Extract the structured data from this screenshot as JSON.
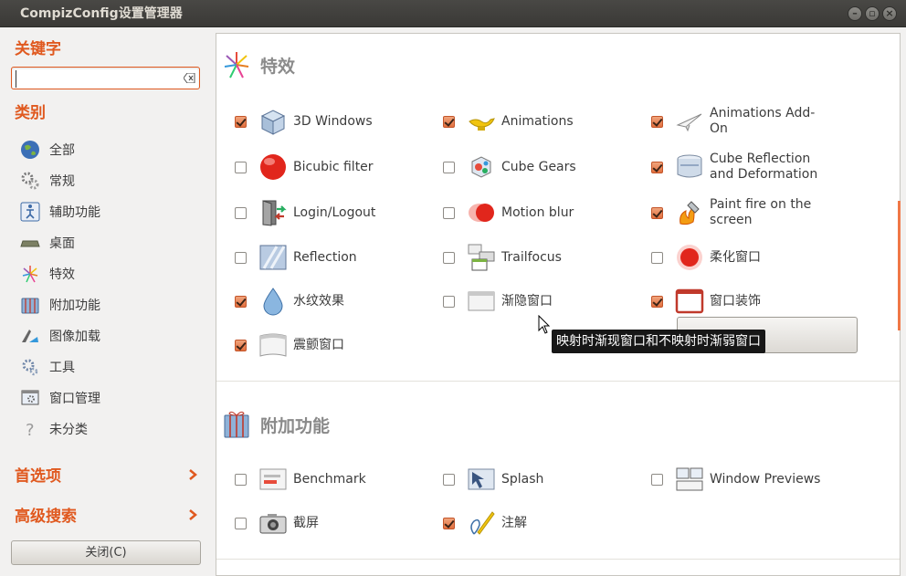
{
  "window": {
    "title": "CompizConfig设置管理器"
  },
  "sidebar": {
    "keyword_heading": "关键字",
    "search_value": "",
    "category_heading": "类别",
    "categories": [
      {
        "label": "全部",
        "icon": "globe-icon"
      },
      {
        "label": "常规",
        "icon": "gears-icon"
      },
      {
        "label": "辅助功能",
        "icon": "accessibility-icon"
      },
      {
        "label": "桌面",
        "icon": "desktop-icon"
      },
      {
        "label": "特效",
        "icon": "fireworks-icon"
      },
      {
        "label": "附加功能",
        "icon": "gift-icon"
      },
      {
        "label": "图像加载",
        "icon": "image-loading-icon"
      },
      {
        "label": "工具",
        "icon": "tools-icon"
      },
      {
        "label": "窗口管理",
        "icon": "window-management-icon"
      },
      {
        "label": "未分类",
        "icon": "question-icon"
      }
    ],
    "preferences_label": "首选项",
    "advanced_search_label": "高级搜索",
    "close_label": "关闭(C)"
  },
  "sections": [
    {
      "title": "特效",
      "icon": "fireworks-icon",
      "plugins": [
        {
          "label": "3D Windows",
          "checked": true,
          "icon": "3d-windows-icon"
        },
        {
          "label": "Animations",
          "checked": true,
          "icon": "magic-lamp-icon"
        },
        {
          "label": "Animations Add-On",
          "checked": true,
          "icon": "paper-plane-icon"
        },
        {
          "label": "Bicubic filter",
          "checked": false,
          "icon": "red-sphere-icon"
        },
        {
          "label": "Cube Gears",
          "checked": false,
          "icon": "cube-gears-icon"
        },
        {
          "label": "Cube Reflection and Deformation",
          "checked": true,
          "icon": "cylinder-icon"
        },
        {
          "label": "Login/Logout",
          "checked": false,
          "icon": "door-icon"
        },
        {
          "label": "Motion blur",
          "checked": false,
          "icon": "motion-blur-icon"
        },
        {
          "label": "Paint fire on the screen",
          "checked": true,
          "icon": "fire-icon"
        },
        {
          "label": "Reflection",
          "checked": false,
          "icon": "reflection-icon"
        },
        {
          "label": "Trailfocus",
          "checked": false,
          "icon": "trailfocus-icon"
        },
        {
          "label": "柔化窗口",
          "checked": false,
          "icon": "glow-sphere-icon"
        },
        {
          "label": "水纹效果",
          "checked": true,
          "icon": "water-drop-icon"
        },
        {
          "label": "渐隐窗口",
          "checked": false,
          "icon": "fading-window-icon"
        },
        {
          "label": "窗口装饰",
          "checked": true,
          "icon": "window-decoration-icon"
        },
        {
          "label": "震颤窗口",
          "checked": true,
          "icon": "wobbly-window-icon"
        }
      ]
    },
    {
      "title": "附加功能",
      "icon": "gift-icon",
      "plugins": [
        {
          "label": "Benchmark",
          "checked": false,
          "icon": "benchmark-icon"
        },
        {
          "label": "Splash",
          "checked": false,
          "icon": "splash-icon"
        },
        {
          "label": "Window Previews",
          "checked": false,
          "icon": "window-previews-icon"
        },
        {
          "label": "截屏",
          "checked": false,
          "icon": "camera-icon"
        },
        {
          "label": "注解",
          "checked": true,
          "icon": "annotate-icon"
        }
      ]
    }
  ],
  "tooltip": "映射时渐现窗口和不映射时渐弱窗口",
  "colors": {
    "accent": "#e0591f",
    "titlebar": "#3c3b37",
    "checkbox_on": "#e8743f"
  }
}
